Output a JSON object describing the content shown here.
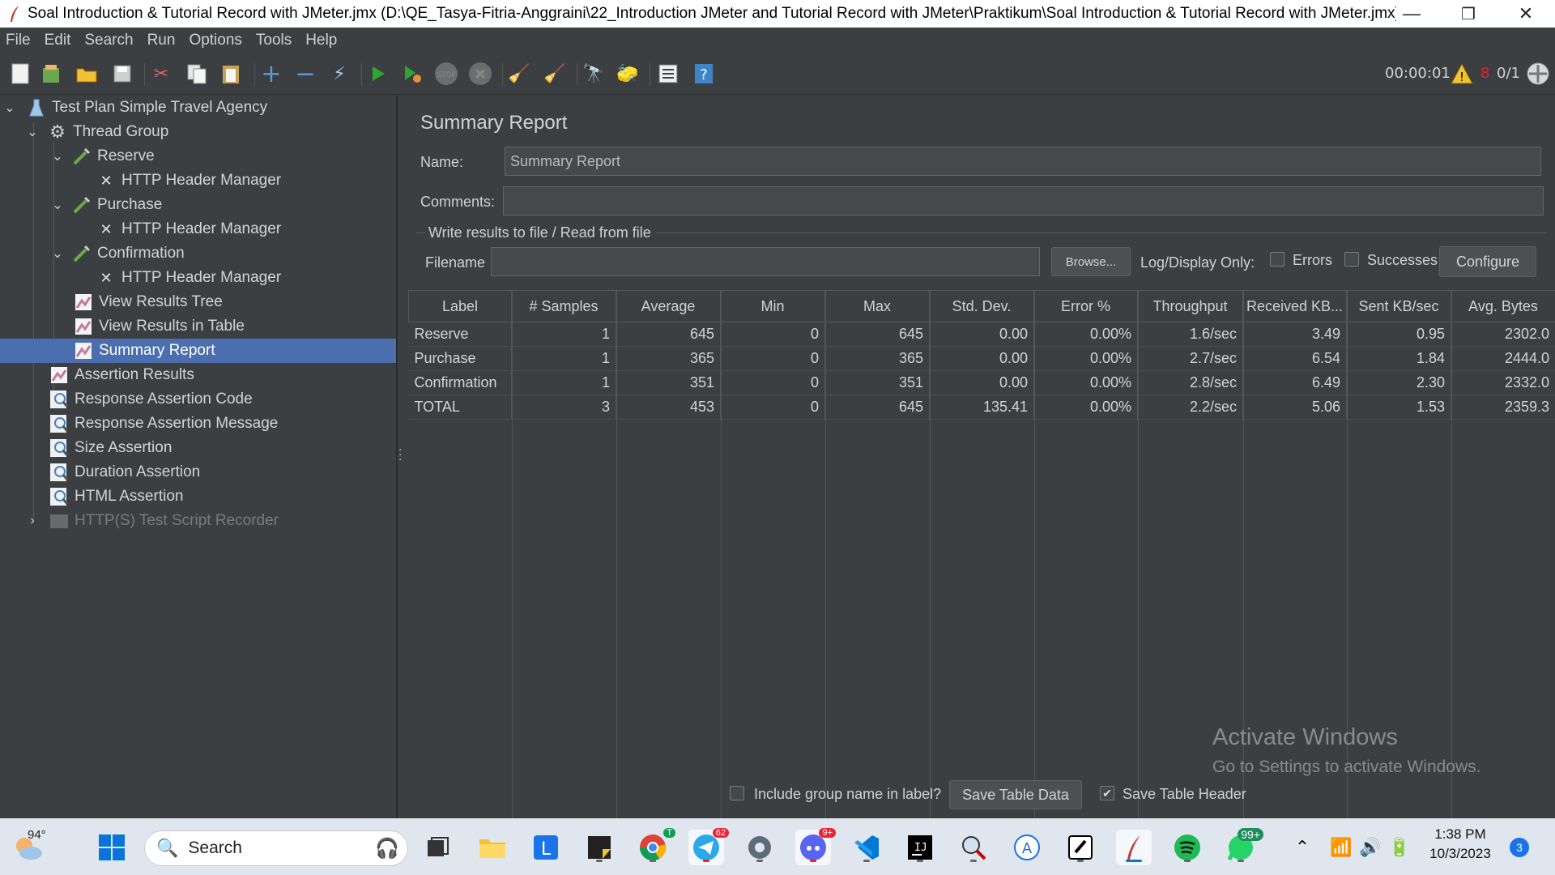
{
  "window": {
    "title": "Soal Introduction & Tutorial Record with JMeter.jmx (D:\\QE_Tasya-Fitria-Anggraini\\22_Introduction JMeter and Tutorial Record with JMeter\\Praktikum\\Soal Introduction & Tutorial Record with JMeter.jmx) - Apac...",
    "minimize": "—",
    "restore": "❐",
    "close": "✕"
  },
  "menu": [
    "File",
    "Edit",
    "Search",
    "Run",
    "Options",
    "Tools",
    "Help"
  ],
  "toolbar": {
    "timer": "00:00:01",
    "warning_count": "8",
    "threads": "0/1"
  },
  "tree": {
    "test_plan": "Test Plan Simple Travel Agency",
    "thread_group": "Thread Group",
    "reserve": "Reserve",
    "reserve_header": "HTTP Header Manager",
    "purchase": "Purchase",
    "purchase_header": "HTTP Header Manager",
    "confirmation": "Confirmation",
    "confirmation_header": "HTTP Header Manager",
    "view_results_tree": "View Results Tree",
    "view_results_table": "View Results in Table",
    "summary_report": "Summary Report",
    "assertion_results": "Assertion Results",
    "response_assertion_code": "Response Assertion Code",
    "response_assertion_message": "Response Assertion Message",
    "size_assertion": "Size Assertion",
    "duration_assertion": "Duration Assertion",
    "html_assertion": "HTML Assertion",
    "recorder": "HTTP(S) Test Script Recorder"
  },
  "panel": {
    "heading": "Summary Report",
    "name_label": "Name:",
    "name_value": "Summary Report",
    "comments_label": "Comments:",
    "comments_value": "",
    "file_group": "Write results to file / Read from file",
    "filename_label": "Filename",
    "filename_value": "",
    "browse": "Browse...",
    "log_display": "Log/Display Only:",
    "errors": "Errors",
    "successes": "Successes",
    "configure": "Configure"
  },
  "table": {
    "headers": [
      "Label",
      "# Samples",
      "Average",
      "Min",
      "Max",
      "Std. Dev.",
      "Error %",
      "Throughput",
      "Received KB...",
      "Sent KB/sec",
      "Avg. Bytes"
    ],
    "rows": [
      [
        "Reserve",
        "1",
        "645",
        "0",
        "645",
        "0.00",
        "0.00%",
        "1.6/sec",
        "3.49",
        "0.95",
        "2302.0"
      ],
      [
        "Purchase",
        "1",
        "365",
        "0",
        "365",
        "0.00",
        "0.00%",
        "2.7/sec",
        "6.54",
        "1.84",
        "2444.0"
      ],
      [
        "Confirmation",
        "1",
        "351",
        "0",
        "351",
        "0.00",
        "0.00%",
        "2.8/sec",
        "6.49",
        "2.30",
        "2332.0"
      ],
      [
        "TOTAL",
        "3",
        "453",
        "0",
        "645",
        "135.41",
        "0.00%",
        "2.2/sec",
        "5.06",
        "1.53",
        "2359.3"
      ]
    ]
  },
  "footer": {
    "include_group": "Include group name in label?",
    "save_table_data": "Save Table Data",
    "save_table_header": "Save Table Header"
  },
  "watermark": {
    "line1": "Activate Windows",
    "line2": "Go to Settings to activate Windows."
  },
  "taskbar": {
    "weather": "94°",
    "search": "Search",
    "time": "1:38 PM",
    "date": "10/3/2023",
    "notifications": "3",
    "telegram_badge": "62",
    "discord_badge": "9+",
    "whatsapp_badge": "99+",
    "chrome_badge": "T"
  }
}
